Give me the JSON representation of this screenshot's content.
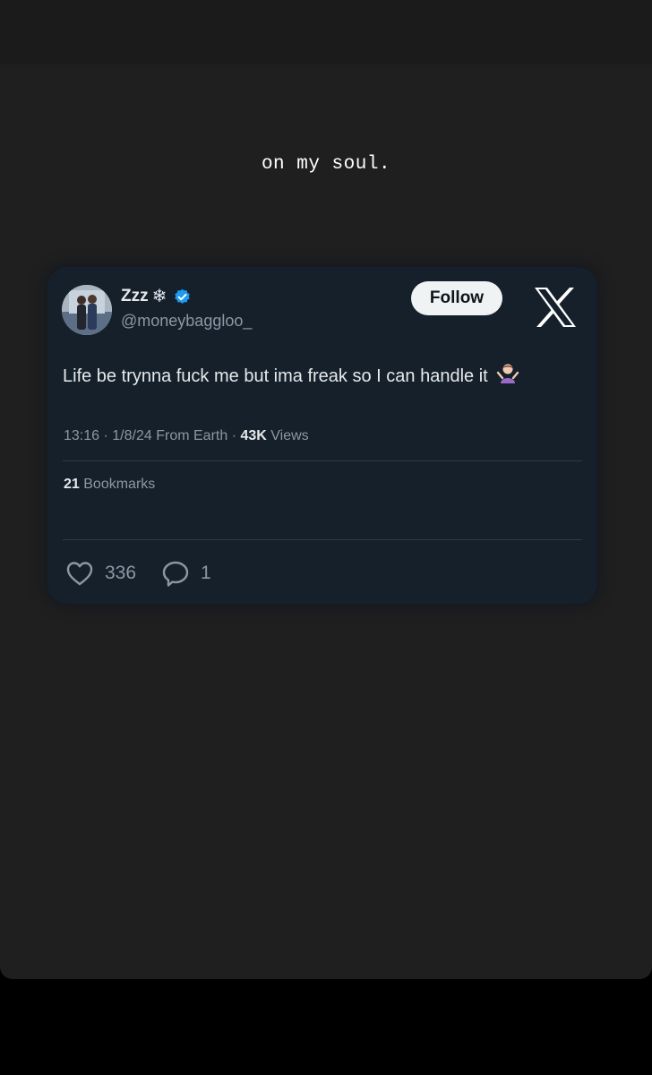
{
  "story": {
    "caption": "on my soul."
  },
  "tweet": {
    "display_name": "Zzz",
    "name_emoji": "❄",
    "verified_icon": "verified-badge-icon",
    "handle": "@moneybaggloo_",
    "follow_label": "Follow",
    "platform_icon": "x-logo-icon",
    "text": "Life be trynna fuck me but ima freak so I can handle it",
    "text_emoji": "person-shrugging-icon",
    "time": "13:16",
    "date": "1/8/24",
    "location": "From Earth",
    "views_count": "43K",
    "views_label": "Views",
    "bookmarks_count": "21",
    "bookmarks_label": "Bookmarks",
    "likes": "336",
    "replies": "1",
    "colors": {
      "card_bg": "#15202b",
      "verified_blue": "#1d9bf0",
      "text_primary": "#e7e9ea",
      "text_secondary": "#8b98a5"
    }
  }
}
